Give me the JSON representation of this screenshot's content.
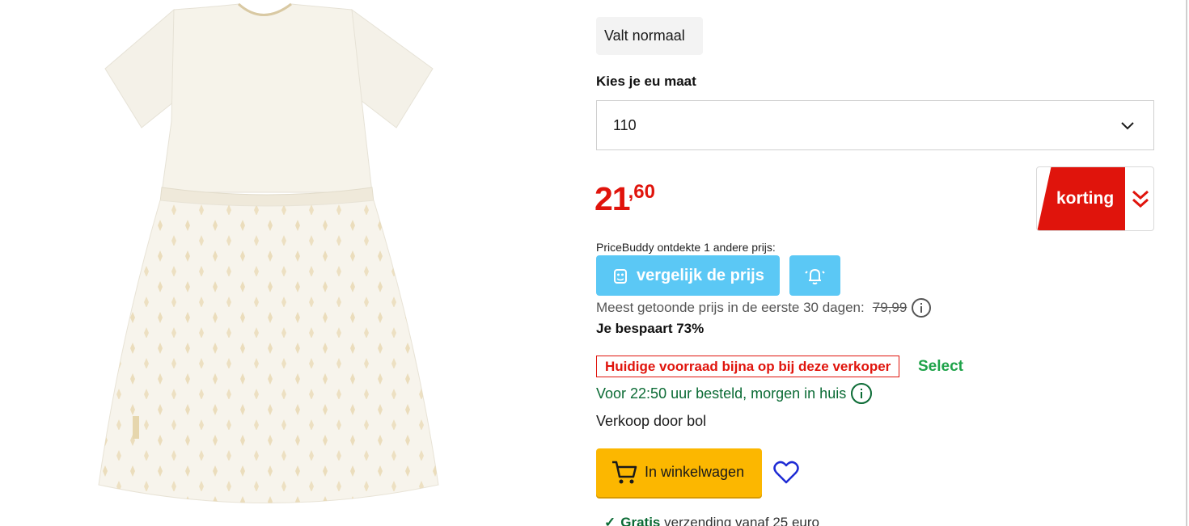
{
  "product": {
    "image_icon": "dress-photo"
  },
  "fit": {
    "label": "Valt normaal"
  },
  "size": {
    "heading": "Kies je eu maat",
    "selected": "110"
  },
  "price": {
    "integer": "21",
    "decimal": ",60",
    "color": "#e0140c"
  },
  "discount": {
    "label": "korting"
  },
  "pricebuddy": {
    "text": "PriceBuddy ontdekte 1 andere prijs:",
    "compare_label": "vergelijk de prijs",
    "color": "#5bc8f5"
  },
  "reference_price": {
    "label": "Meest getoonde prijs in de eerste 30 dagen:",
    "value": "79,99"
  },
  "savings": "Je bespaart 73%",
  "stock": {
    "warning": "Huidige voorraad bijna op bij deze verkoper",
    "select_label": "Select"
  },
  "delivery": "Voor 22:50 uur besteld, morgen in huis",
  "seller": "Verkoop door bol",
  "cart": {
    "label": "In winkelwagen",
    "color": "#fcb700"
  },
  "shipping": {
    "bold": "Gratis",
    "rest": "verzending vanaf 25 euro"
  }
}
